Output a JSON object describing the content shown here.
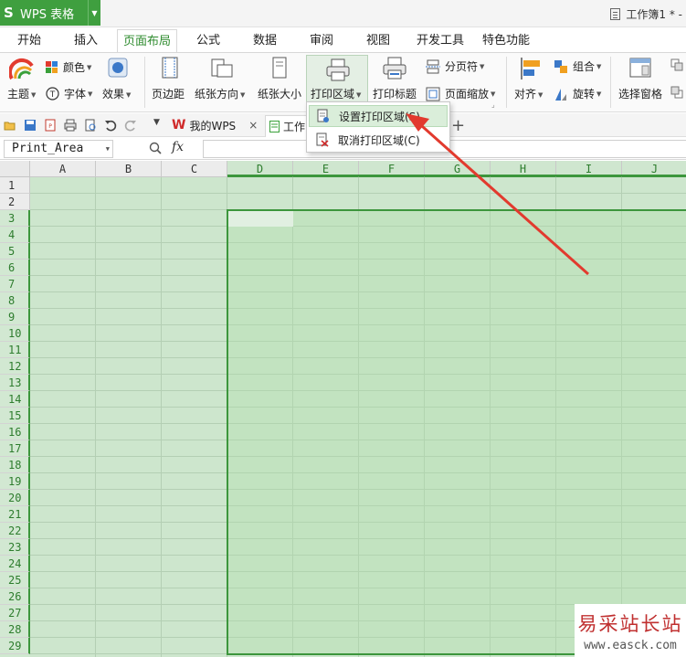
{
  "app": {
    "logo": "S",
    "title": "WPS 表格"
  },
  "document": {
    "title": "工作簿1 * -"
  },
  "tabs": [
    {
      "label": "开始",
      "active": false
    },
    {
      "label": "插入",
      "active": false
    },
    {
      "label": "页面布局",
      "active": true
    },
    {
      "label": "公式",
      "active": false
    },
    {
      "label": "数据",
      "active": false
    },
    {
      "label": "审阅",
      "active": false
    },
    {
      "label": "视图",
      "active": false
    },
    {
      "label": "开发工具",
      "active": false
    },
    {
      "label": "特色功能",
      "active": false
    }
  ],
  "ribbon": {
    "theme": "主题",
    "color": "颜色",
    "font": "字体",
    "effect": "效果",
    "margin": "页边距",
    "orientation": "纸张方向",
    "size": "纸张大小",
    "print_area": "打印区域",
    "print_titles": "打印标题",
    "page_break": "分页符",
    "page_zoom": "页面缩放",
    "align": "对齐",
    "group": "组合",
    "rotate": "旋转",
    "selection_pane": "选择窗格"
  },
  "doc_tabs": {
    "wps": "我的WPS",
    "close": "×",
    "book": "工作",
    "add": "+"
  },
  "formula_bar": {
    "name_box": "Print_Area",
    "fx": "fx",
    "value": ""
  },
  "dropdown": {
    "set_print_area": "设置打印区域(S)",
    "cancel_print_area": "取消打印区域(C)"
  },
  "sheet": {
    "columns": [
      "A",
      "B",
      "C",
      "D",
      "E",
      "F",
      "G",
      "H",
      "I",
      "J"
    ],
    "rows": [
      "1",
      "2",
      "3",
      "4",
      "5",
      "6",
      "7",
      "8",
      "9",
      "10",
      "11",
      "12",
      "13",
      "14",
      "15",
      "16",
      "17",
      "18",
      "19",
      "20",
      "21",
      "22",
      "23",
      "24",
      "25",
      "26",
      "27",
      "28",
      "29"
    ],
    "selected_columns": [
      "D",
      "E",
      "F",
      "G",
      "H",
      "I",
      "J"
    ],
    "selected_rows_from": 3
  },
  "watermark": {
    "cn": "易采站长站",
    "url": "www.easck.com"
  },
  "colors": {
    "accent": "#3f9f3f",
    "selection": "#3c963c",
    "arrow": "#e23a2e"
  }
}
